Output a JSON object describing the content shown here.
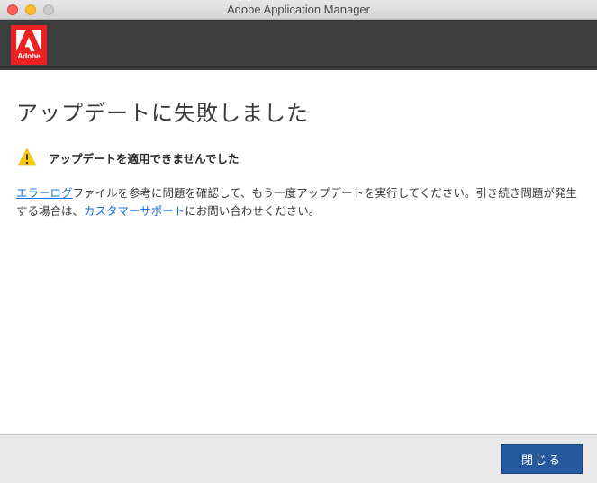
{
  "titlebar": {
    "title": "Adobe Application Manager"
  },
  "logo": {
    "brand": "Adobe"
  },
  "content": {
    "heading": "アップデートに失敗しました",
    "warning_text": "アップデートを適用できませんでした",
    "body_link1": "エラーログ",
    "body_part1": "ファイルを参考に問題を確認して、もう一度アップデートを実行してください。引き続き問題が発生する場合は、",
    "body_link2": "カスタマーサポート",
    "body_part2": "にお問い合わせください。"
  },
  "footer": {
    "close_label": "閉じる"
  }
}
